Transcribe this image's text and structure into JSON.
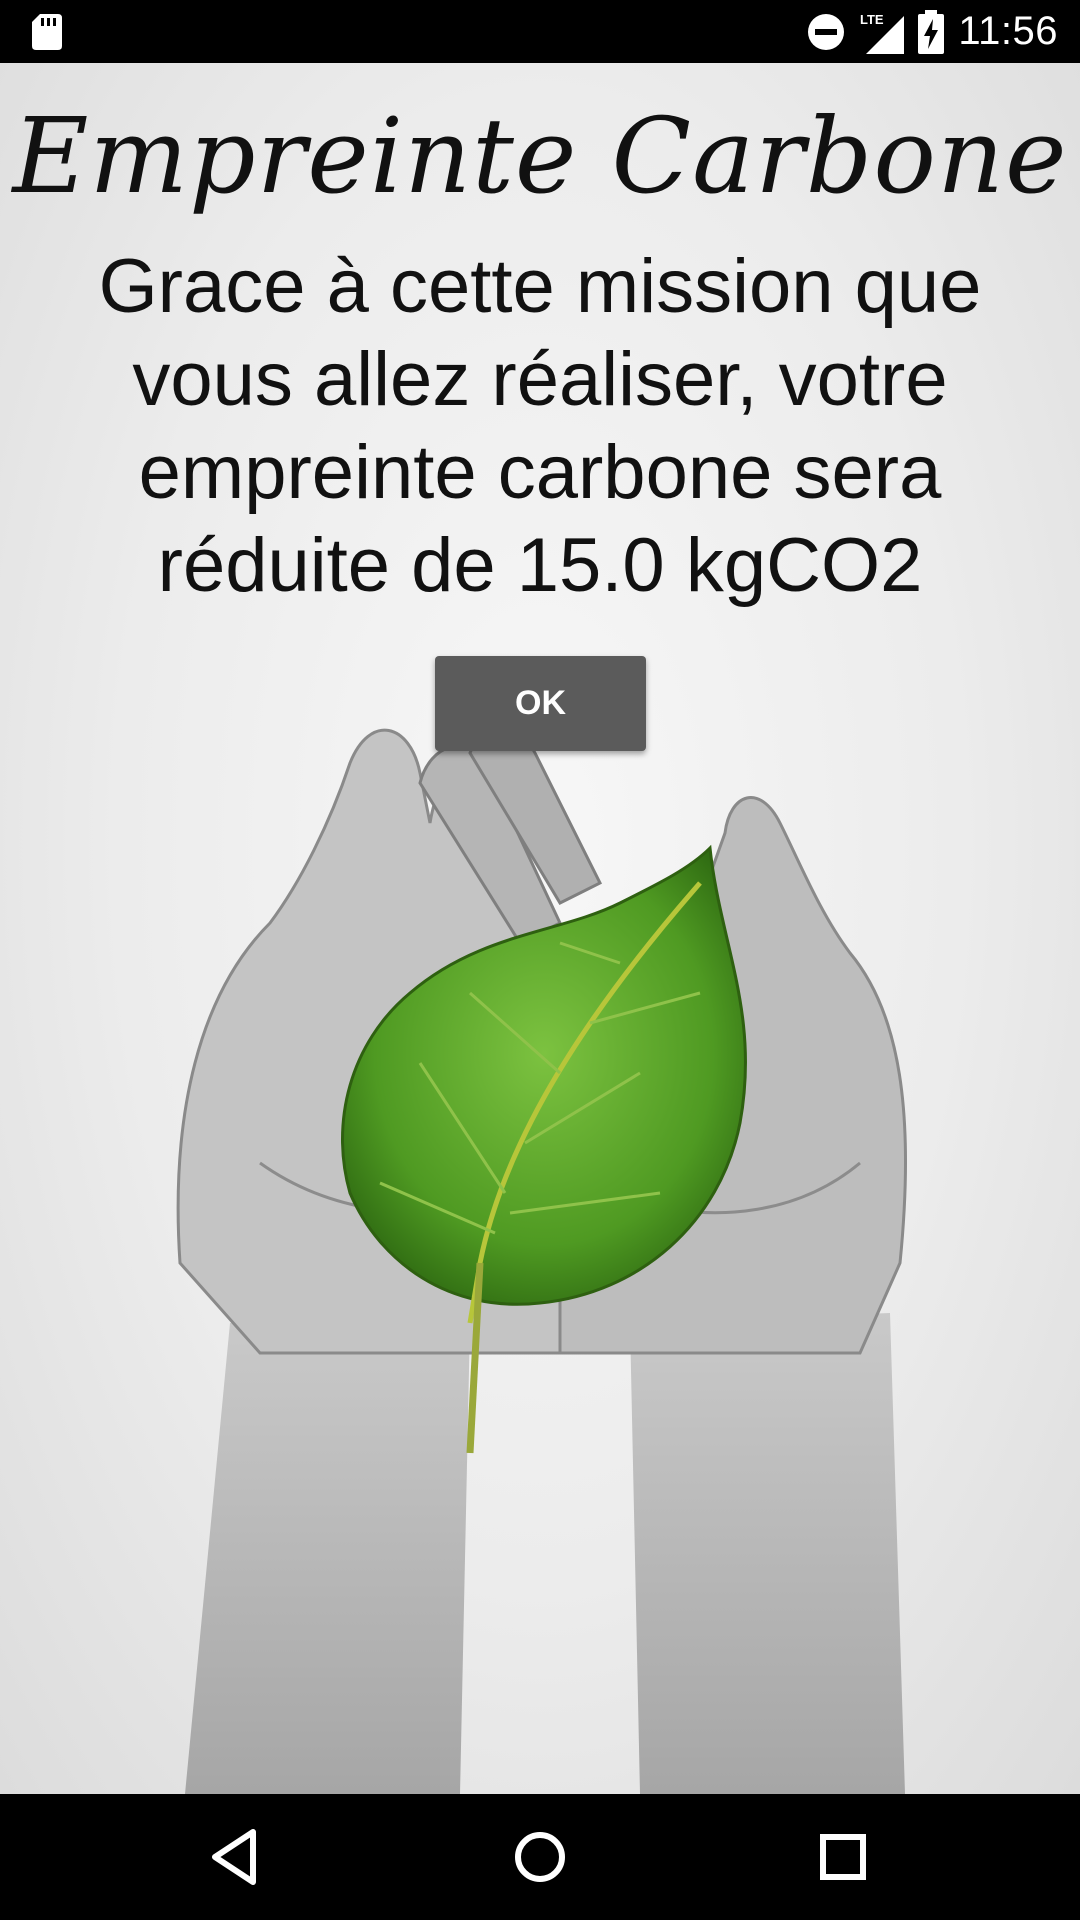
{
  "status_bar": {
    "network_label": "LTE",
    "time": "11:56",
    "icons": [
      "sd-card-icon",
      "do-not-disturb-icon",
      "signal-icon",
      "battery-charging-icon"
    ]
  },
  "screen": {
    "title": "Empreinte Carbone",
    "message_lines": [
      "Grace à cette mission que",
      "vous allez réaliser, votre",
      "empreinte carbone sera",
      "réduite de 15.0 kgCO2"
    ],
    "ok_button": "OK",
    "background_image": "hands-holding-green-leaf"
  },
  "nav_bar": {
    "icons": [
      "back-icon",
      "home-icon",
      "recents-icon"
    ]
  },
  "colors": {
    "button_bg": "#5b5b5b",
    "leaf_green": "#5fa82e",
    "bars": "#000000"
  }
}
